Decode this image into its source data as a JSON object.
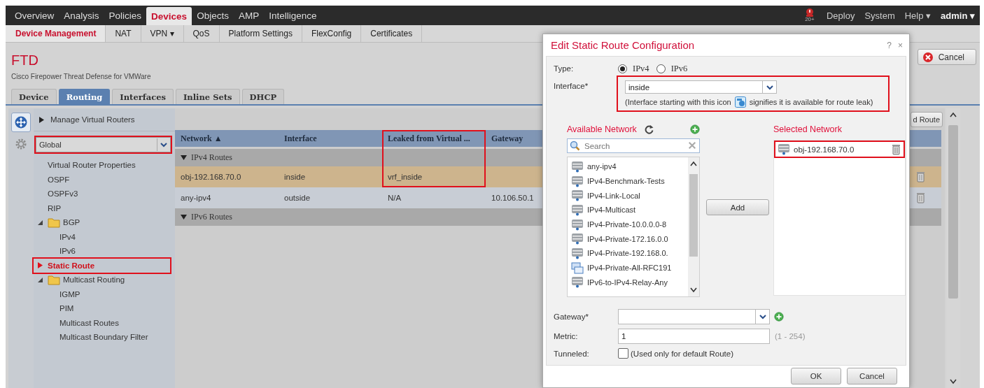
{
  "top_nav": {
    "items": [
      {
        "label": "Overview",
        "selected": false
      },
      {
        "label": "Analysis",
        "selected": false
      },
      {
        "label": "Policies",
        "selected": false
      },
      {
        "label": "Devices",
        "selected": true
      },
      {
        "label": "Objects",
        "selected": false
      },
      {
        "label": "AMP",
        "selected": false
      },
      {
        "label": "Intelligence",
        "selected": false
      }
    ],
    "alert_count": "20+",
    "user_items": [
      {
        "label": "Deploy",
        "kind": "link"
      },
      {
        "label": "System",
        "kind": "link"
      },
      {
        "label": "Help ▾",
        "kind": "link"
      },
      {
        "label": "admin ▾",
        "kind": "user"
      }
    ]
  },
  "sub_nav": [
    {
      "label": "Device Management",
      "selected": true
    },
    {
      "label": "NAT",
      "selected": false
    },
    {
      "label": "VPN ▾",
      "selected": false
    },
    {
      "label": "QoS",
      "selected": false
    },
    {
      "label": "Platform Settings",
      "selected": false
    },
    {
      "label": "FlexConfig",
      "selected": false
    },
    {
      "label": "Certificates",
      "selected": false
    }
  ],
  "device": {
    "name": "FTD",
    "description": "Cisco Firepower Threat Defense for VMWare",
    "cancel_button": "Cancel"
  },
  "device_tabs": [
    {
      "label": "Device",
      "selected": false
    },
    {
      "label": "Routing",
      "selected": true
    },
    {
      "label": "Interfaces",
      "selected": false
    },
    {
      "label": "Inline Sets",
      "selected": false
    },
    {
      "label": "DHCP",
      "selected": false
    }
  ],
  "rail": [
    {
      "kind": "router",
      "selected": true
    },
    {
      "kind": "settings",
      "selected": false
    }
  ],
  "sidebar": {
    "title": "Manage Virtual Routers",
    "router": {
      "value": "Global",
      "highlighted": true
    },
    "items": [
      {
        "label": "Virtual Router Properties",
        "selected": false,
        "highlighted": false
      },
      {
        "label": "OSPF",
        "selected": false,
        "highlighted": false
      },
      {
        "label": "OSPFv3",
        "selected": false,
        "highlighted": false
      },
      {
        "label": "RIP",
        "selected": false,
        "highlighted": false
      },
      {
        "label": "BGP",
        "expanded": true,
        "selected": false,
        "highlighted": false,
        "children": [
          {
            "label": "IPv4",
            "selected": false,
            "highlighted": false
          },
          {
            "label": "IPv6",
            "selected": false,
            "highlighted": false
          }
        ]
      },
      {
        "label": "Static Route",
        "selected": true,
        "highlighted": true
      },
      {
        "label": "Multicast Routing",
        "expanded": true,
        "selected": false,
        "highlighted": false,
        "children": [
          {
            "label": "IGMP",
            "selected": false,
            "highlighted": false
          },
          {
            "label": "PIM",
            "selected": false,
            "highlighted": false
          },
          {
            "label": "Multicast Routes",
            "selected": false,
            "highlighted": false
          },
          {
            "label": "Multicast Boundary Filter",
            "selected": false,
            "highlighted": false
          }
        ]
      }
    ]
  },
  "routes": {
    "add_button": "d Route",
    "columns": [
      {
        "label": "Network ▲"
      },
      {
        "label": "Interface"
      },
      {
        "label": "Leaked from Virtual ...",
        "highlighted": true
      },
      {
        "label": "Gateway"
      }
    ],
    "groups": [
      {
        "label": "IPv4 Routes",
        "expanded": true,
        "rows": [
          {
            "network": "obj-192.168.70.0",
            "interface": "inside",
            "leaked_from": "vrf_inside",
            "selected": true,
            "highlighted": true
          },
          {
            "network": "any-ipv4",
            "interface": "outside",
            "leaked_from": "N/A",
            "gateway": "10.106.50.1",
            "selected": false,
            "highlighted": false
          }
        ]
      },
      {
        "label": "IPv6 Routes",
        "expanded": true
      }
    ]
  },
  "dialog": {
    "title": "Edit Static Route Configuration",
    "help": "?",
    "close": "×",
    "type": {
      "label": "Type:",
      "options": [
        {
          "label": "IPv4",
          "selected": true
        },
        {
          "label": "IPv6",
          "selected": false
        }
      ]
    },
    "interface": {
      "label": "Interface*",
      "value": "inside",
      "note_before": "(Interface starting with this icon",
      "note_after": "signifies it is available for route leak)",
      "highlighted": true
    },
    "available": {
      "title": "Available Network",
      "placeholder": "Search",
      "items": [
        {
          "label": "any-ipv4",
          "kind": "network"
        },
        {
          "label": "IPv4-Benchmark-Tests",
          "kind": "network"
        },
        {
          "label": "IPv4-Link-Local",
          "kind": "network"
        },
        {
          "label": "IPv4-Multicast",
          "kind": "network"
        },
        {
          "label": "IPv4-Private-10.0.0.0-8",
          "kind": "network"
        },
        {
          "label": "IPv4-Private-172.16.0.0",
          "kind": "network"
        },
        {
          "label": "IPv4-Private-192.168.0.",
          "kind": "network"
        },
        {
          "label": "IPv4-Private-All-RFC191",
          "kind": "group"
        },
        {
          "label": "IPv6-to-IPv4-Relay-Any",
          "kind": "network"
        }
      ]
    },
    "add_button": "Add",
    "selected": {
      "title": "Selected Network",
      "items": [
        {
          "label": "obj-192.168.70.0",
          "highlighted": true
        }
      ]
    },
    "gateway": {
      "label": "Gateway*"
    },
    "metric": {
      "label": "Metric:",
      "value": "1",
      "range": "(1 - 254)"
    },
    "tunneled": {
      "label": "Tunneled:",
      "checked": false,
      "note": "(Used only for default Route)"
    },
    "buttons": [
      "OK",
      "Cancel"
    ]
  }
}
